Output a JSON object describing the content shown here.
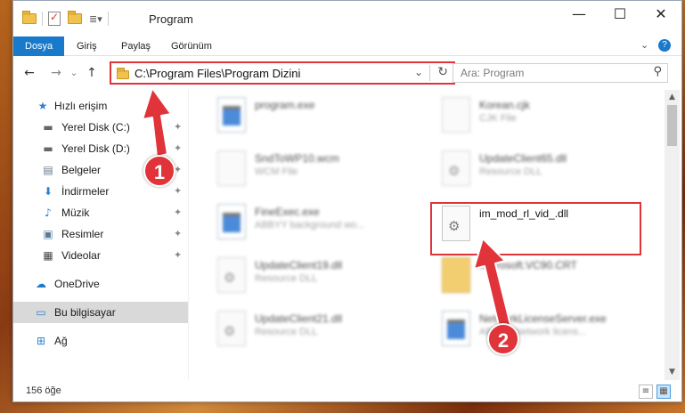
{
  "window": {
    "title": "Program",
    "controls": {
      "minimize": "—",
      "maximize": "☐",
      "close": "✕"
    }
  },
  "ribbon": {
    "tabs": [
      "Dosya",
      "Giriş",
      "Paylaş",
      "Görünüm"
    ],
    "active_tab": "Dosya"
  },
  "nav": {
    "back": "←",
    "forward": "→",
    "recent": "⌄",
    "up": "↑",
    "address": "C:\\Program Files\\Program Dizini",
    "search_placeholder": "Ara: Program"
  },
  "sidebar": {
    "items": [
      {
        "label": "Hızlı erişim",
        "icon": "star-icon",
        "glyph": "★",
        "pinned": false
      },
      {
        "label": "Yerel Disk (C:)",
        "icon": "drive-icon",
        "glyph": "▬",
        "pinned": true
      },
      {
        "label": "Yerel Disk (D:)",
        "icon": "drive-icon",
        "glyph": "▬",
        "pinned": true
      },
      {
        "label": "Belgeler",
        "icon": "documents-icon",
        "glyph": "▤",
        "pinned": true
      },
      {
        "label": "İndirmeler",
        "icon": "download-icon",
        "glyph": "⬇",
        "pinned": true
      },
      {
        "label": "Müzik",
        "icon": "music-icon",
        "glyph": "♪",
        "pinned": true
      },
      {
        "label": "Resimler",
        "icon": "pictures-icon",
        "glyph": "▣",
        "pinned": true
      },
      {
        "label": "Videolar",
        "icon": "videos-icon",
        "glyph": "▦",
        "pinned": true
      },
      {
        "label": "OneDrive",
        "icon": "cloud-icon",
        "glyph": "☁",
        "pinned": false
      },
      {
        "label": "Bu bilgisayar",
        "icon": "computer-icon",
        "glyph": "▭",
        "pinned": false,
        "selected": true
      },
      {
        "label": "Ağ",
        "icon": "network-icon",
        "glyph": "⊞",
        "pinned": false
      }
    ],
    "pin_glyph": "📌"
  },
  "files": [
    {
      "name": "program.exe",
      "type": "",
      "kind": "exe"
    },
    {
      "name": "Korean.cjk",
      "type": "CJK File",
      "kind": "doc"
    },
    {
      "name": "SndToWP10.wcm",
      "type": "WCM File",
      "kind": "doc"
    },
    {
      "name": "UpdateClient65.dll",
      "type": "Resource DLL",
      "kind": "dll"
    },
    {
      "name": "FineExec.exe",
      "type": "ABBYY background wo...",
      "kind": "exe"
    },
    {
      "name": "im_mod_rl_vid_.dll",
      "type": "",
      "kind": "dll",
      "highlighted": true
    },
    {
      "name": "UpdateClient19.dll",
      "type": "Resource DLL",
      "kind": "dll"
    },
    {
      "name": "Microsoft.VC90.CRT",
      "type": "",
      "kind": "folder"
    },
    {
      "name": "UpdateClient21.dll",
      "type": "Resource DLL",
      "kind": "dll"
    },
    {
      "name": "NetworkLicenseServer.exe",
      "type": "ABBYY Network licens...",
      "kind": "exe"
    }
  ],
  "status": {
    "item_count": "156 öğe"
  },
  "callouts": [
    {
      "number": "1",
      "color": "#e0333a"
    },
    {
      "number": "2",
      "color": "#e0333a"
    }
  ],
  "accent": "#1979ca"
}
